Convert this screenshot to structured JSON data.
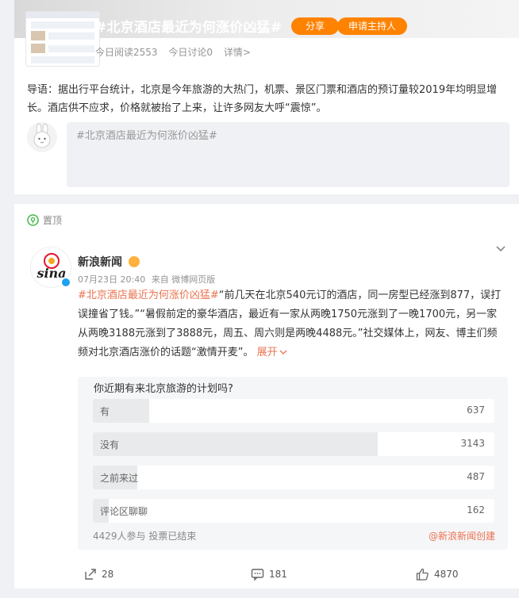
{
  "topic": {
    "title": "#北京酒店最近为何涨价凶猛#",
    "share_label": "分享",
    "host_label": "申请主持人",
    "stats": [
      "今日阅读2553",
      "今日讨论0",
      "详情>"
    ],
    "intro": "导语：据出行平台统计，北京是今年旅游的大热门，机票、景区门票和酒店的预订量较2019年均明显增长。酒店供不应求，价格就被抬了上来，让许多网友大呼“震惊”。",
    "compose_placeholder": "#北京酒店最近为何涨价凶猛#"
  },
  "post": {
    "pin_label": "置顶",
    "author": "新浪新闻",
    "time": "07月23日 20:40",
    "source": "来自 微博网页版",
    "text_hashtag": "#北京酒店最近为何涨价凶猛#",
    "text_body": "“前几天在北京540元订的酒店，同一房型已经涨到877，误打误撞省了钱。”“暑假前定的豪华酒店，最近有一家从两晚1750元涨到了一晚1700元，另一家从两晚3188元涨到了3888元，周五、周六则是两晚4488元。”社交媒体上，网友、博主们频频对北京酒店涨价的话题“激情开麦”。",
    "expand_label": "展开",
    "logo_text": "sina"
  },
  "poll": {
    "question": "你近期有来北京旅游的计划吗?",
    "options": [
      {
        "label": "有",
        "count": "637",
        "fraction": 0.14
      },
      {
        "label": "没有",
        "count": "3143",
        "fraction": 0.71
      },
      {
        "label": "之前来过",
        "count": "487",
        "fraction": 0.11
      },
      {
        "label": "评论区聊聊",
        "count": "162",
        "fraction": 0.04
      }
    ],
    "footer": "4429人参与 投票已结束",
    "creator": "@新浪新闻创建"
  },
  "actions": {
    "repost": "28",
    "comment": "181",
    "like": "4870"
  },
  "colors": {
    "accent": "#ff8200",
    "link": "#eb7350",
    "verified": "#1da1f2"
  }
}
